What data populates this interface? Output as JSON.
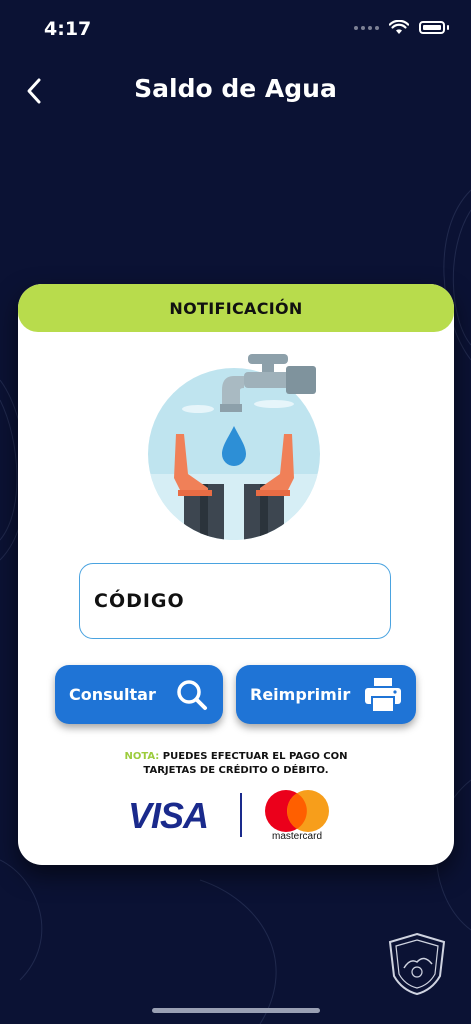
{
  "status_bar": {
    "time": "4:17"
  },
  "header": {
    "title": "Saldo de Agua"
  },
  "card": {
    "header_label": "NOTIFICACIÓN",
    "code_field": {
      "value": "CÓDIGO"
    },
    "buttons": {
      "consult_label": "Consultar",
      "reprint_label": "Reimprimir"
    },
    "note": {
      "label": "NOTA:",
      "text_line1": "PUEDES EFECTUAR EL PAGO CON",
      "text_line2": "TARJETAS DE CRÉDITO O DÉBITO."
    },
    "payment_methods": {
      "visa": "VISA",
      "mastercard": "mastercard"
    }
  },
  "icons": [
    "back-chevron-icon",
    "wifi-icon",
    "battery-icon",
    "faucet-hands-illustration",
    "search-icon",
    "printer-icon",
    "municipality-emblem"
  ],
  "colors": {
    "background": "#0b1234",
    "header_band": "#b8dc4c",
    "button": "#1f74d6",
    "field_border": "#4aa3e0",
    "note_label": "#9ccc3c"
  }
}
